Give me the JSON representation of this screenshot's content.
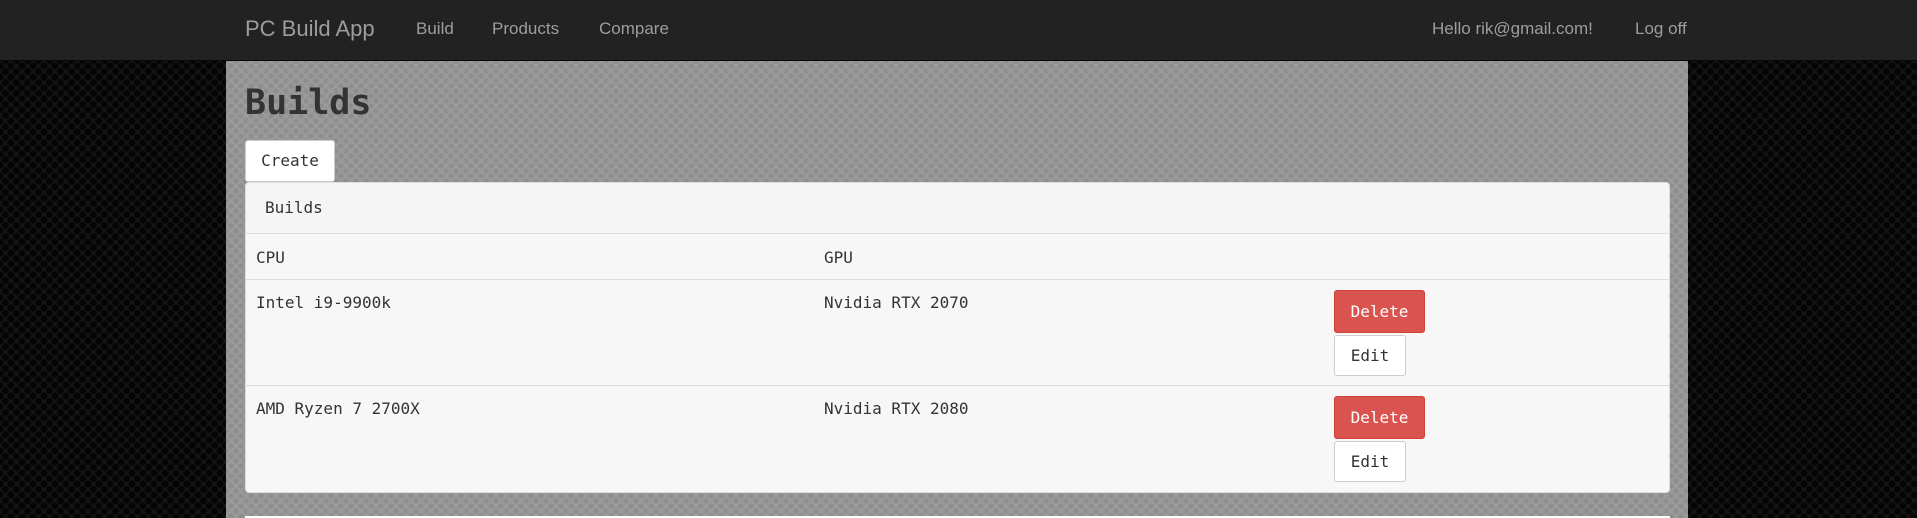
{
  "navbar": {
    "brand": "PC Build App",
    "links": [
      "Build",
      "Products",
      "Compare"
    ],
    "greeting": "Hello rik@gmail.com!",
    "logoff": "Log off"
  },
  "page": {
    "title": "Builds",
    "create_label": "Create"
  },
  "panel": {
    "heading": "Builds",
    "columns": [
      "CPU",
      "GPU"
    ],
    "rows": [
      {
        "cpu": "Intel i9-9900k",
        "gpu": "Nvidia RTX 2070",
        "delete_label": "Delete",
        "edit_label": "Edit"
      },
      {
        "cpu": "AMD Ryzen 7 2700X",
        "gpu": "Nvidia RTX 2080",
        "delete_label": "Delete",
        "edit_label": "Edit"
      }
    ]
  },
  "colors": {
    "navbar": "#222222",
    "danger": "#d9534f",
    "nav_text": "#9d9d9d"
  }
}
